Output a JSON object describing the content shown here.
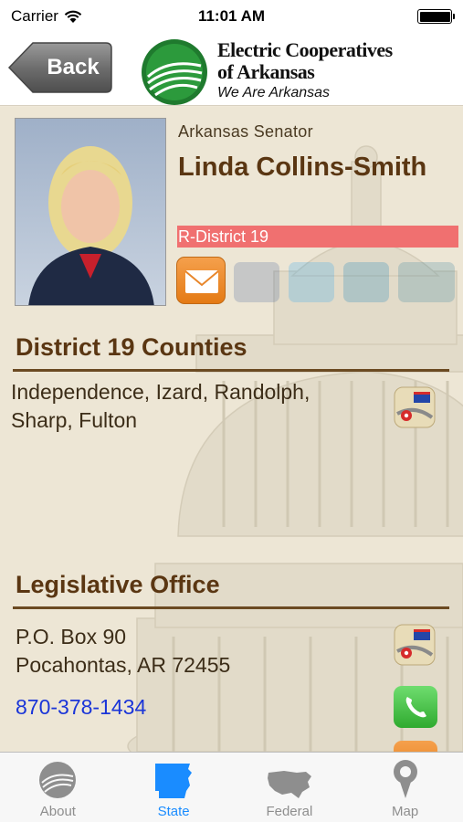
{
  "status_bar": {
    "carrier": "Carrier",
    "time": "11:01 AM",
    "battery_level": 1.0
  },
  "header": {
    "back_label": "Back",
    "logo_line1": "Electric Cooperatives",
    "logo_line2": "of Arkansas",
    "logo_tagline": "We Are Arkansas"
  },
  "profile": {
    "title": "Arkansas Senator",
    "name": "Linda Collins-Smith",
    "district": "R-District 19",
    "social_icons": [
      "facebook-icon",
      "twitter-icon",
      "linkedin-icon",
      "web-icon"
    ]
  },
  "counties": {
    "heading": "District 19 Counties",
    "list": "Independence, Izard, Randolph, Sharp, Fulton"
  },
  "office": {
    "heading": "Legislative Office",
    "address_line1": "P.O. Box 90",
    "address_line2": "Pocahontas, AR 72455",
    "phone": "870-378-1434"
  },
  "tabs": [
    {
      "label": "About",
      "icon": "cooperative-logo-icon",
      "active": false
    },
    {
      "label": "State",
      "icon": "arkansas-map-icon",
      "active": true
    },
    {
      "label": "Federal",
      "icon": "usa-map-icon",
      "active": false
    },
    {
      "label": "Map",
      "icon": "map-pin-icon",
      "active": false
    }
  ],
  "colors": {
    "accent": "#1a8cff",
    "district_bar": "#f07070",
    "heading_brown": "#5a3612",
    "link_blue": "#1a35d8"
  }
}
